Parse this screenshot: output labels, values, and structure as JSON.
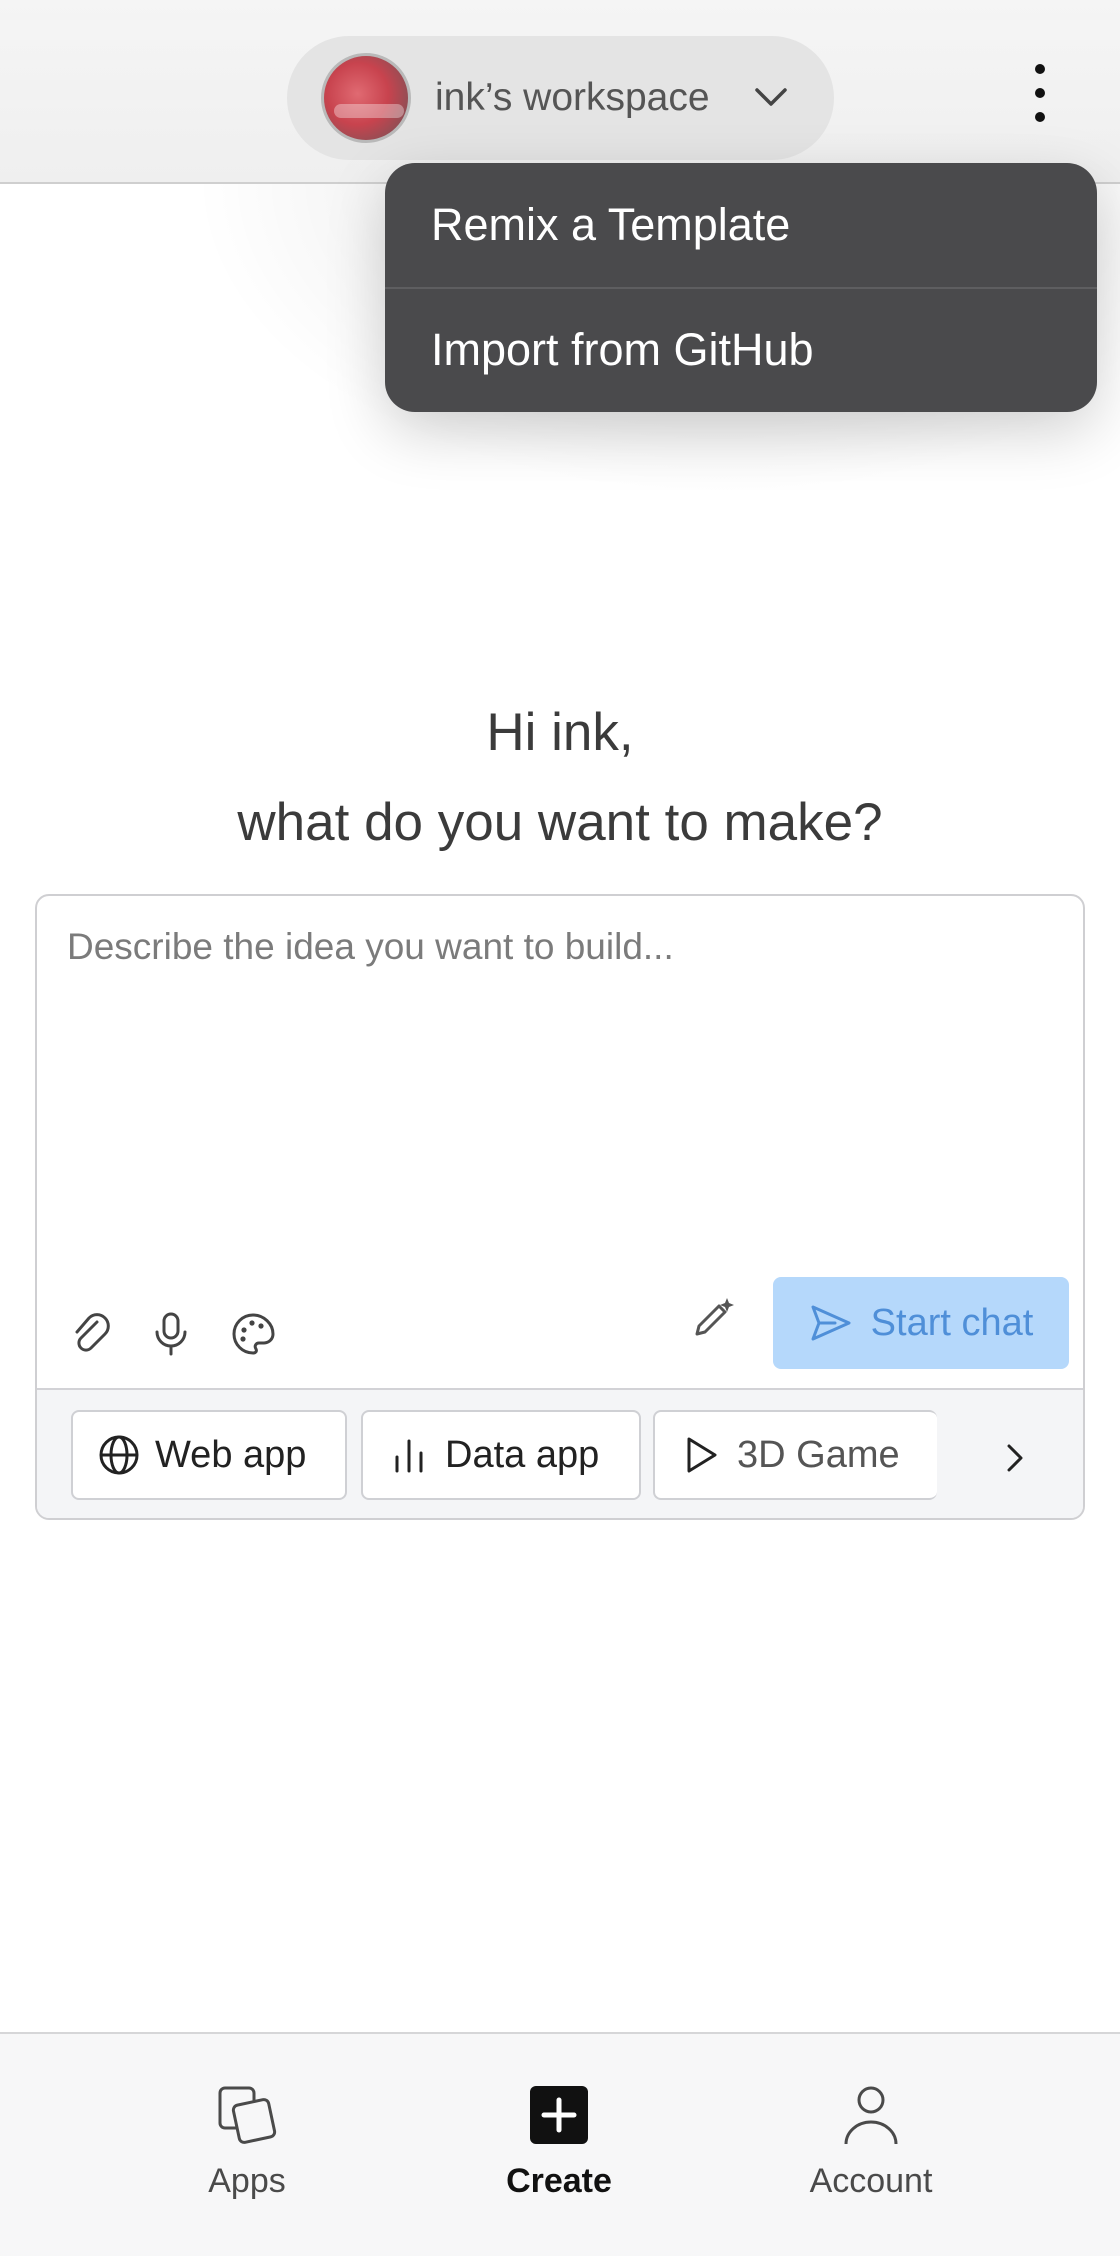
{
  "header": {
    "workspace_name": "ink’s workspace",
    "avatar_icon": "avatar-image",
    "dropdown_icon": "chevron-down-icon",
    "menu_icon": "kebab-menu-icon"
  },
  "dropdown_menu": {
    "items": [
      {
        "label": "Remix a Template"
      },
      {
        "label": "Import from GitHub"
      }
    ],
    "background": "#4a4a4c"
  },
  "greeting": {
    "line1": "Hi ink,",
    "line2": "what do you want to make?"
  },
  "prompt": {
    "placeholder": "Describe the idea you want to build...",
    "value": "",
    "tools": [
      "paperclip-icon",
      "microphone-icon",
      "palette-icon",
      "magic-wand-icon"
    ],
    "start_chat_label": "Start chat",
    "start_chat_color": "#b5d8fb"
  },
  "chips": [
    {
      "label": "Web app",
      "icon": "globe-icon"
    },
    {
      "label": "Data app",
      "icon": "bar-chart-icon"
    },
    {
      "label": "3D Game",
      "icon": "play-icon"
    }
  ],
  "bottom_nav": {
    "items": [
      {
        "label": "Apps",
        "icon": "apps-icon",
        "active": false
      },
      {
        "label": "Create",
        "icon": "plus-square-icon",
        "active": true
      },
      {
        "label": "Account",
        "icon": "person-icon",
        "active": false
      }
    ]
  }
}
